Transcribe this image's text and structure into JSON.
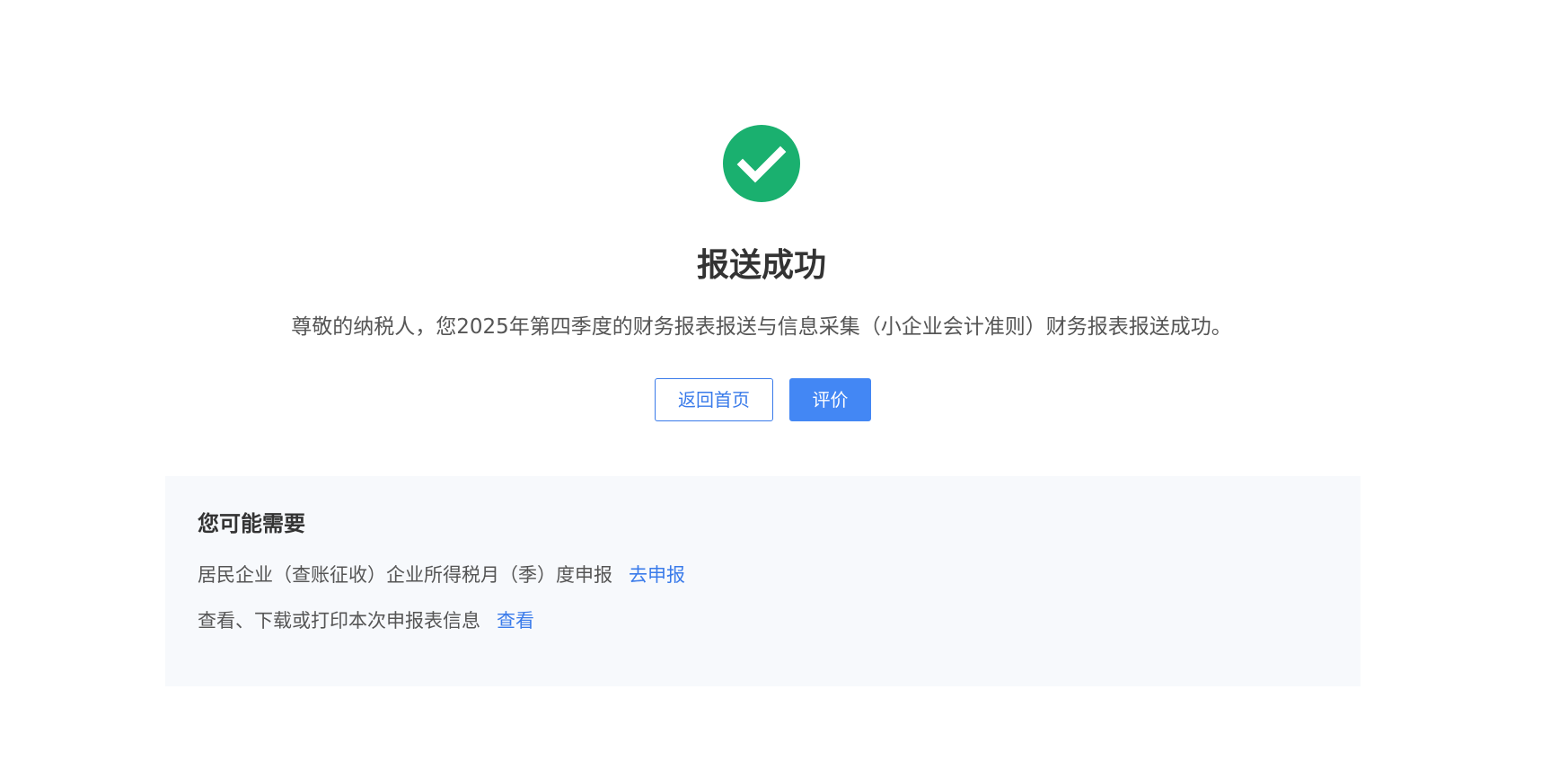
{
  "result": {
    "title": "报送成功",
    "message": "尊敬的纳税人，您2025年第四季度的财务报表报送与信息采集（小企业会计准则）财务报表报送成功。",
    "icon": "check-circle-icon",
    "icon_color": "#1ab06f"
  },
  "actions": {
    "home_label": "返回首页",
    "rate_label": "评价",
    "primary_color": "#4387f4"
  },
  "suggestions": {
    "title": "您可能需要",
    "items": [
      {
        "text": "居民企业（查账征收）企业所得税月（季）度申报",
        "link": "去申报"
      },
      {
        "text": "查看、下载或打印本次申报表信息",
        "link": "查看"
      }
    ]
  }
}
